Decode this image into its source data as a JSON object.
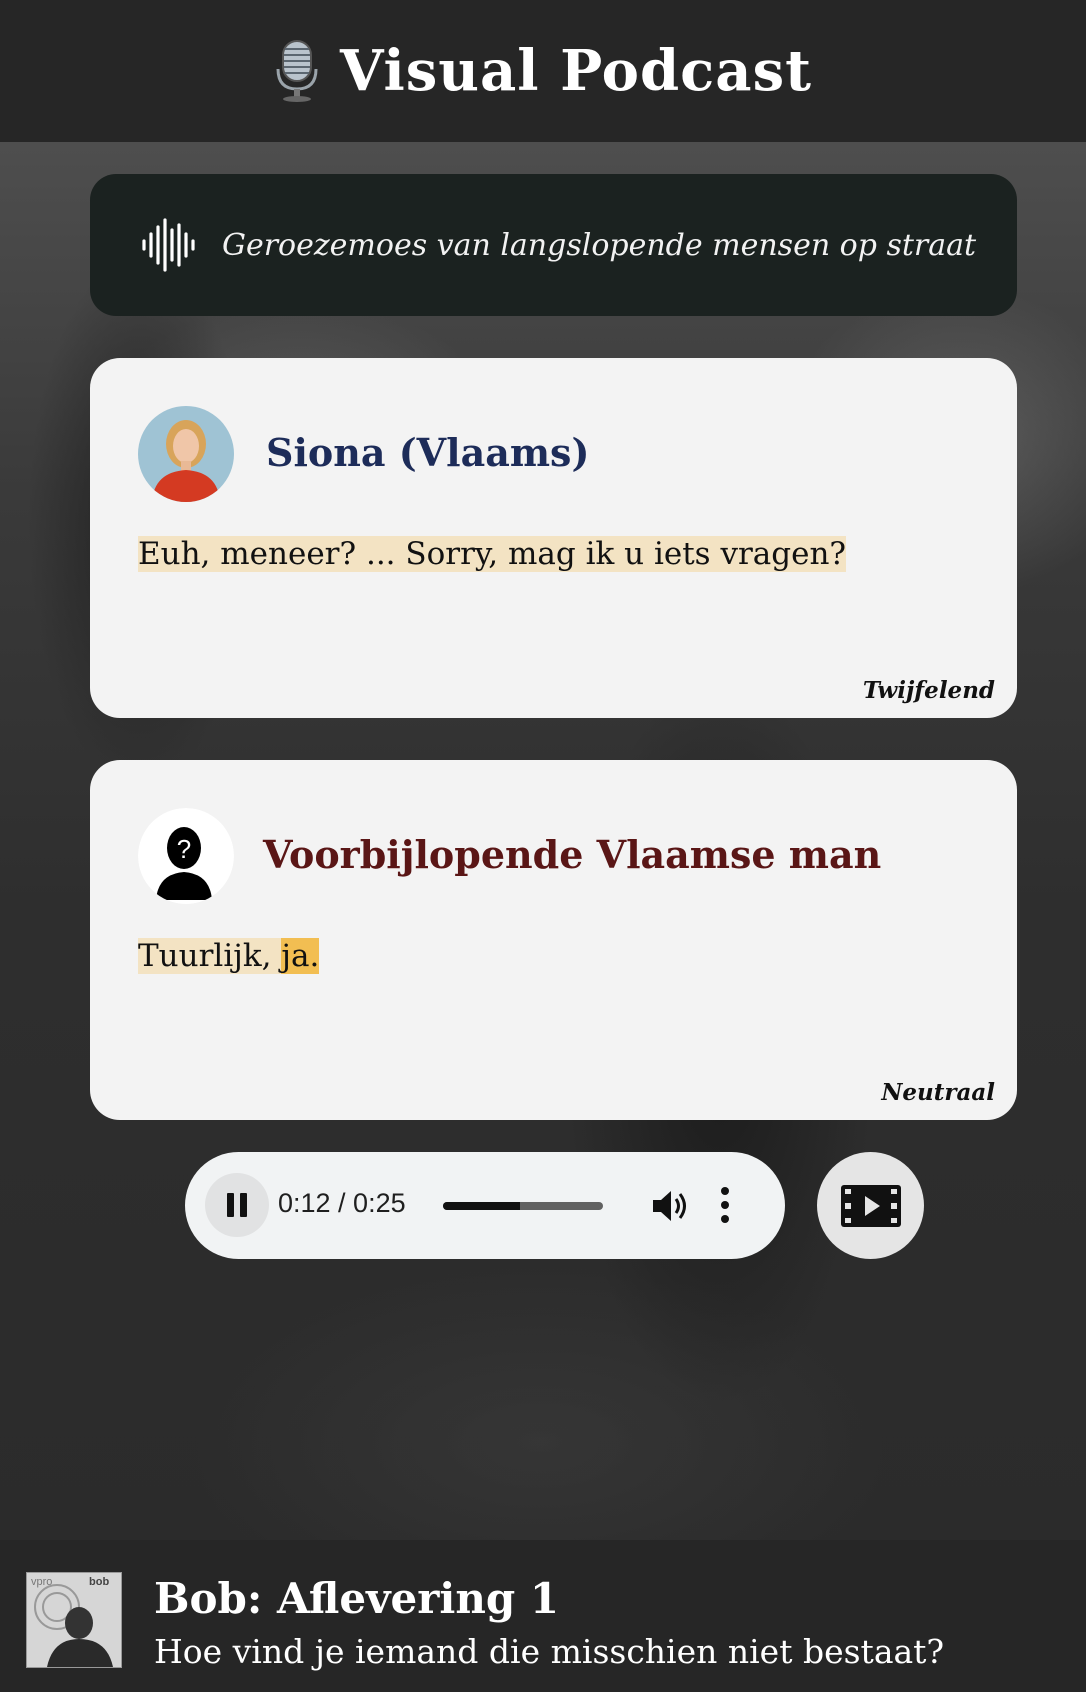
{
  "header": {
    "title": "Visual Podcast",
    "icon": "microphone-icon"
  },
  "ambience": {
    "icon": "sound-wave-icon",
    "text": "Geroezemoes van langslopende mensen op straat"
  },
  "cards": [
    {
      "speaker": "Siona (Vlaams)",
      "speaker_color": "#1d2c59",
      "line": "Euh, meneer? ... Sorry, mag ik u iets vragen?",
      "emotion": "Twijfelend"
    },
    {
      "speaker": "Voorbijlopende Vlaamse man",
      "speaker_color": "#5a1616",
      "line_part1": "Tuurlijk, ",
      "line_part2": "ja.",
      "emotion": "Neutraal"
    }
  ],
  "player": {
    "time": "0:12 / 0:25",
    "progress": 0.48,
    "state": "playing"
  },
  "footer": {
    "title": "Bob: Aflevering 1",
    "subtitle": "Hoe vind je iemand die misschien niet bestaat?",
    "thumb_label_left": "vpro",
    "thumb_label_right": "bob"
  },
  "colors": {
    "highlight": "#f3e3c3",
    "highlight_active": "#f2be52"
  }
}
